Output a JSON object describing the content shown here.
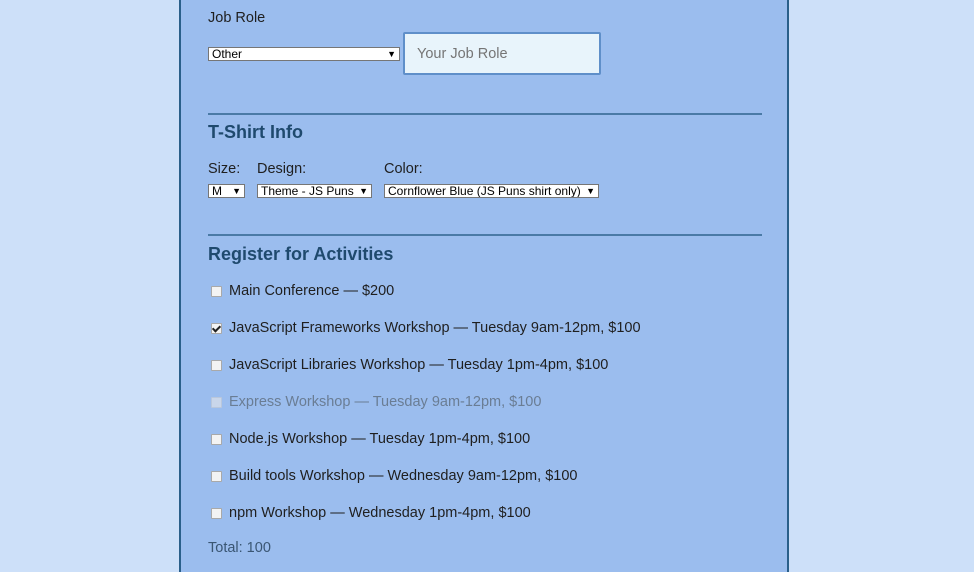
{
  "job_role": {
    "label": "Job Role",
    "selected": "Other",
    "input_placeholder": "Your Job Role"
  },
  "tshirt": {
    "heading": "T-Shirt Info",
    "size_label": "Size:",
    "size_selected": "M",
    "design_label": "Design:",
    "design_selected": "Theme - JS Puns",
    "color_label": "Color:",
    "color_selected": "Cornflower Blue (JS Puns shirt only)"
  },
  "activities": {
    "heading": "Register for Activities",
    "items": [
      {
        "label": "Main Conference — $200",
        "checked": false,
        "disabled": false
      },
      {
        "label": "JavaScript Frameworks Workshop — Tuesday 9am-12pm, $100",
        "checked": true,
        "disabled": false
      },
      {
        "label": "JavaScript Libraries Workshop — Tuesday 1pm-4pm, $100",
        "checked": false,
        "disabled": false
      },
      {
        "label": "Express Workshop — Tuesday 9am-12pm, $100",
        "checked": false,
        "disabled": true
      },
      {
        "label": "Node.js Workshop — Tuesday 1pm-4pm, $100",
        "checked": false,
        "disabled": false
      },
      {
        "label": "Build tools Workshop — Wednesday 9am-12pm, $100",
        "checked": false,
        "disabled": false
      },
      {
        "label": "npm Workshop — Wednesday 1pm-4pm, $100",
        "checked": false,
        "disabled": false
      }
    ],
    "total": "Total: 100"
  },
  "icons": {
    "caret": "▼"
  },
  "colors": {
    "page_background": "#cde0f9",
    "panel_background": "#9bbdee",
    "heading": "#1f4a6e",
    "divider": "#4a7aa6"
  }
}
